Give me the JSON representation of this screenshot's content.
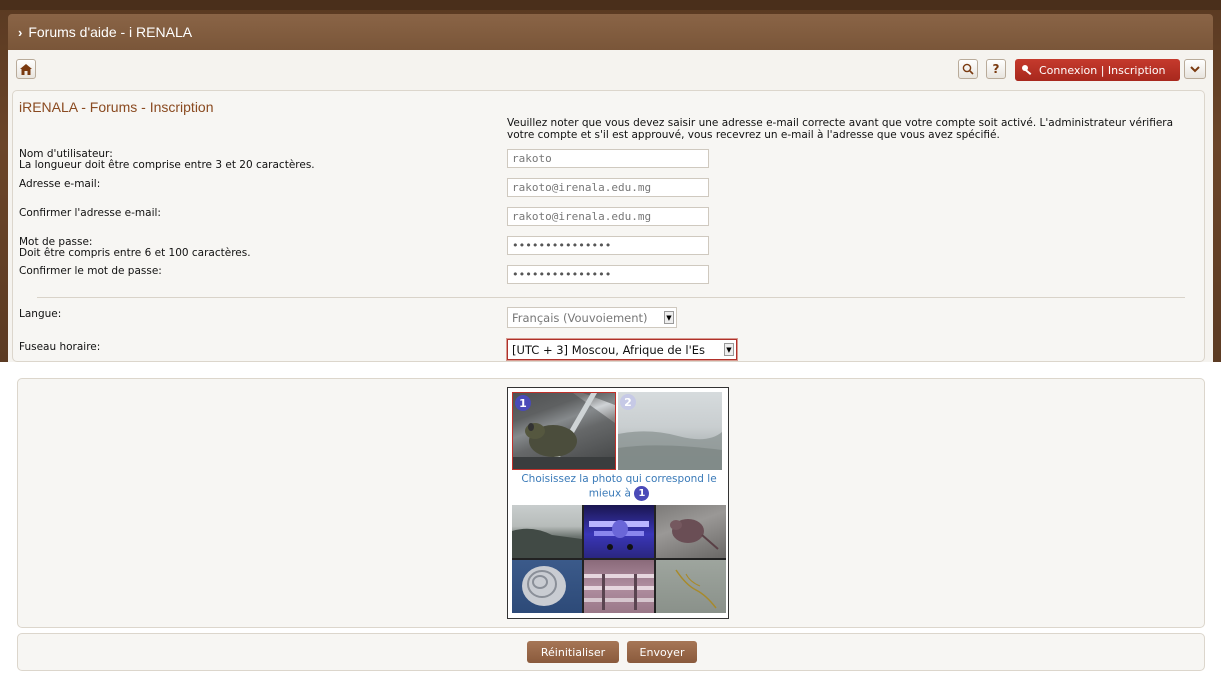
{
  "header": {
    "title": "Forums d'aide - i RENALA"
  },
  "toolbar": {
    "help_label": "?",
    "login_label": "Connexion | Inscription"
  },
  "form": {
    "title": "iRENALA - Forums - Inscription",
    "notice": "Veuillez noter que vous devez saisir une adresse e-mail correcte avant que votre compte soit activé. L'administrateur vérifiera votre compte et s'il est approuvé, vous recevrez un e-mail à l'adresse que vous avez spécifié.",
    "username_label": "Nom d'utilisateur:",
    "username_hint": "La longueur doit être comprise entre 3 et 20 caractères.",
    "username_value": "rakoto",
    "email_label": "Adresse e-mail:",
    "email_value": "rakoto@irenala.edu.mg",
    "email_confirm_label": "Confirmer l'adresse e-mail:",
    "email_confirm_value": "rakoto@irenala.edu.mg",
    "password_label": "Mot de passe:",
    "password_hint": "Doit être compris entre 6 et 100 caractères.",
    "password_value": "•••••••••••••••",
    "password_confirm_label": "Confirmer le mot de passe:",
    "password_confirm_value": "•••••••••••••••",
    "language_label": "Langue:",
    "language_value": "Français (Vouvoiement)",
    "timezone_label": "Fuseau horaire:",
    "timezone_value": "[UTC + 3] Moscou, Afrique de l'Es"
  },
  "captcha": {
    "num1": "1",
    "num2": "2",
    "instruction": "Choisissez la photo qui correspond le mieux à",
    "target_num": "1"
  },
  "actions": {
    "reset_label": "Réinitialiser",
    "submit_label": "Envoyer"
  },
  "colors": {
    "brand_brown": "#6b4529",
    "login_red": "#b8301f",
    "title_brown": "#8a4a20",
    "captcha_blue": "#4a4ab8"
  }
}
